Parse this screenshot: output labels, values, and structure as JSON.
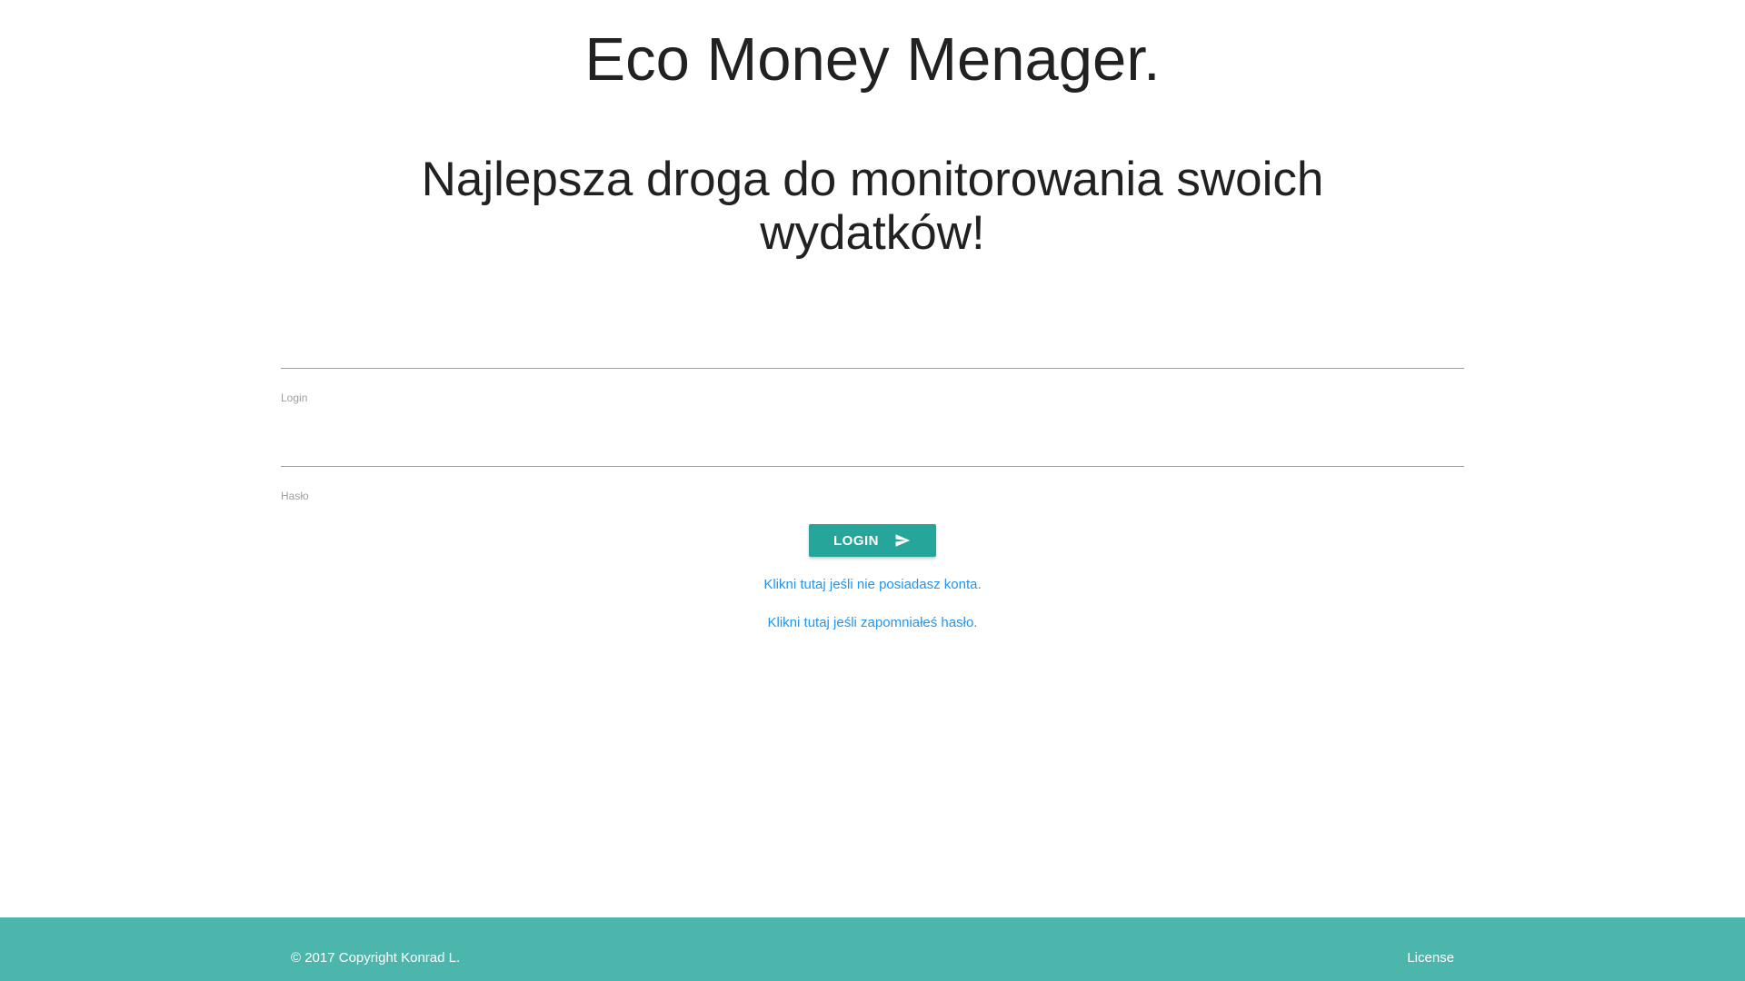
{
  "header": {
    "app_title": "Eco Money Menager.",
    "tagline": "Najlepsza droga do monitorowania swoich wydatków!"
  },
  "form": {
    "login_label": "Login",
    "login_value": "",
    "password_label": "Hasło",
    "password_value": "",
    "submit_label": "LOGIN",
    "submit_icon": "send-icon"
  },
  "links": {
    "register": "Klikni tutaj jeśli nie posiadasz konta.",
    "forgot_password": "Klikni tutaj jeśli zapomniałeś hasło."
  },
  "footer": {
    "copyright": "© 2017 Copyright Konrad L.",
    "license": "License"
  },
  "colors": {
    "accent": "#26a69a",
    "footer_bg": "#4db6ac",
    "link": "#2196f3"
  }
}
